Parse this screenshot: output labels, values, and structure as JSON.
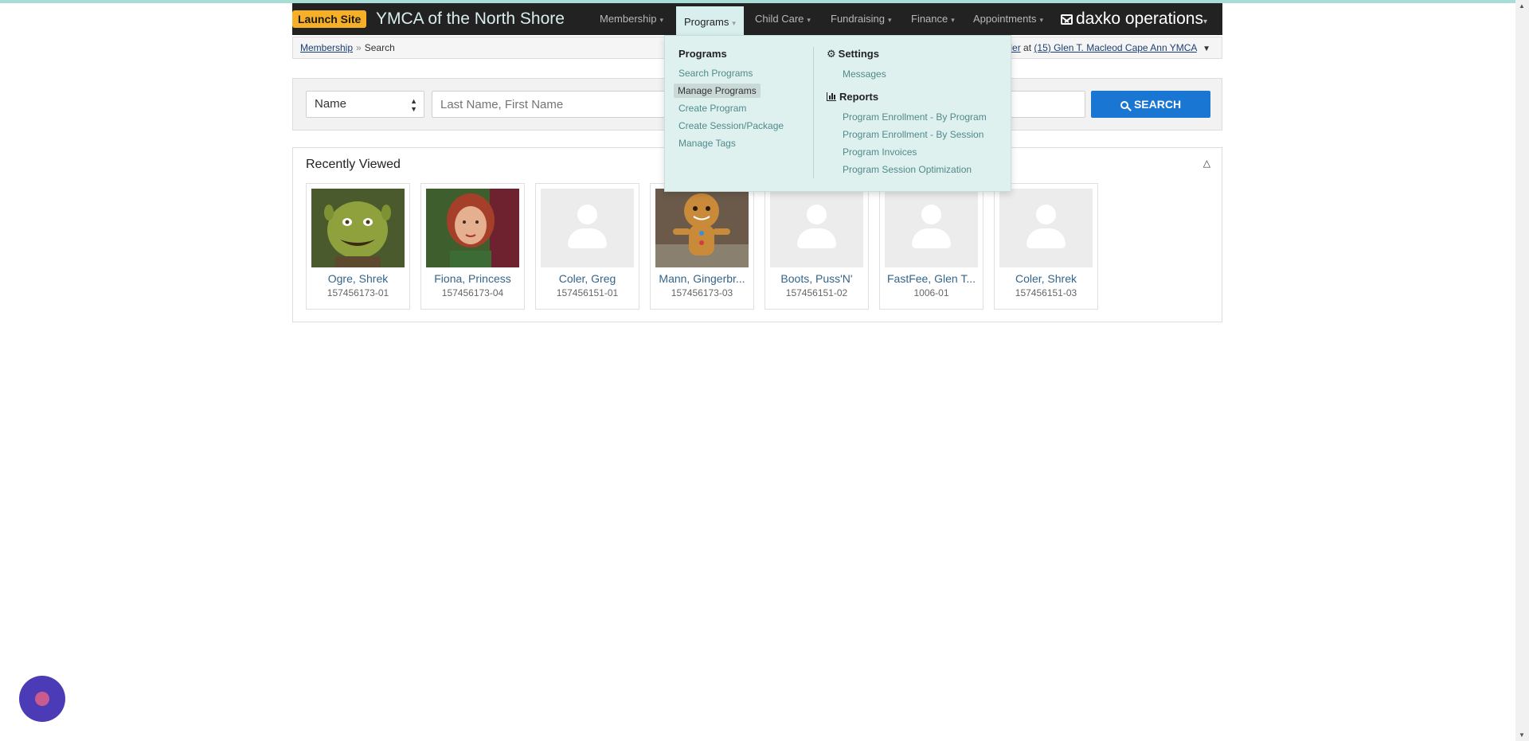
{
  "navbar": {
    "launch_label": "Launch Site",
    "brand": "YMCA of the North Shore",
    "items": [
      {
        "label": "Membership"
      },
      {
        "label": "Programs"
      },
      {
        "label": "Child Care"
      },
      {
        "label": "Fundraising"
      },
      {
        "label": "Finance"
      },
      {
        "label": "Appointments"
      }
    ],
    "product": "daxko operations"
  },
  "breadcrumb": {
    "root": "Membership",
    "separator": "»",
    "current": "Search",
    "right_user": "ler",
    "right_at": "at",
    "right_location": "(15) Glen T. Macleod Cape Ann YMCA"
  },
  "search": {
    "type_selected": "Name",
    "placeholder": "Last Name, First Name",
    "button_label": "SEARCH"
  },
  "recent": {
    "title": "Recently Viewed",
    "cards": [
      {
        "name": "Ogre, Shrek",
        "id": "157456173-01",
        "photo": "shrek"
      },
      {
        "name": "Fiona, Princess",
        "id": "157456173-04",
        "photo": "fiona"
      },
      {
        "name": "Coler, Greg",
        "id": "157456151-01",
        "photo": "placeholder"
      },
      {
        "name": "Mann, Gingerbr...",
        "id": "157456173-03",
        "photo": "gingerbread"
      },
      {
        "name": "Boots, Puss'N'",
        "id": "157456151-02",
        "photo": "placeholder"
      },
      {
        "name": "FastFee, Glen T...",
        "id": "1006-01",
        "photo": "placeholder"
      },
      {
        "name": "Coler, Shrek",
        "id": "157456151-03",
        "photo": "placeholder"
      }
    ]
  },
  "programs_menu": {
    "programs_heading": "Programs",
    "programs_links": [
      "Search Programs",
      "Manage Programs",
      "Create Program",
      "Create Session/Package",
      "Manage Tags"
    ],
    "settings_heading": "Settings",
    "settings_links": [
      "Messages"
    ],
    "reports_heading": "Reports",
    "reports_links": [
      "Program Enrollment - By Program",
      "Program Enrollment - By Session",
      "Program Invoices",
      "Program Session Optimization"
    ]
  },
  "colors": {
    "accent": "#1976d2",
    "navbar": "#222222",
    "launch": "#f5b027",
    "dropdown_bg": "#dff1ef",
    "link": "#4f8a8b"
  }
}
